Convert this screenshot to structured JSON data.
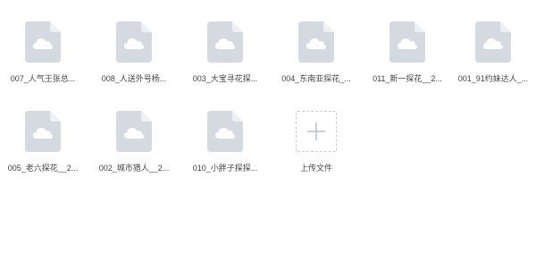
{
  "files": [
    {
      "name": "007_人气王张总...",
      "icon": "cloud-file-icon"
    },
    {
      "name": "008_人送外号杨...",
      "icon": "cloud-file-icon"
    },
    {
      "name": "003_大宝寻花探...",
      "icon": "cloud-file-icon"
    },
    {
      "name": "004_东南亚探花_...",
      "icon": "cloud-file-icon"
    },
    {
      "name": "011_新一探花__2...",
      "icon": "cloud-file-icon"
    },
    {
      "name": "001_91约妹达人_...",
      "icon": "cloud-file-icon"
    },
    {
      "name": "005_老六探花__2...",
      "icon": "cloud-file-icon"
    },
    {
      "name": "002_城市猎人__2...",
      "icon": "cloud-file-icon"
    },
    {
      "name": "010_小胖子探探...",
      "icon": "cloud-file-icon"
    }
  ],
  "upload": {
    "label": "上传文件",
    "icon": "plus-icon"
  },
  "colors": {
    "file_body": "#d5d9e0",
    "file_fold": "#eef0f3",
    "cloud": "#ffffff",
    "upload_border": "#c9ced6",
    "plus": "#b8bec8"
  }
}
